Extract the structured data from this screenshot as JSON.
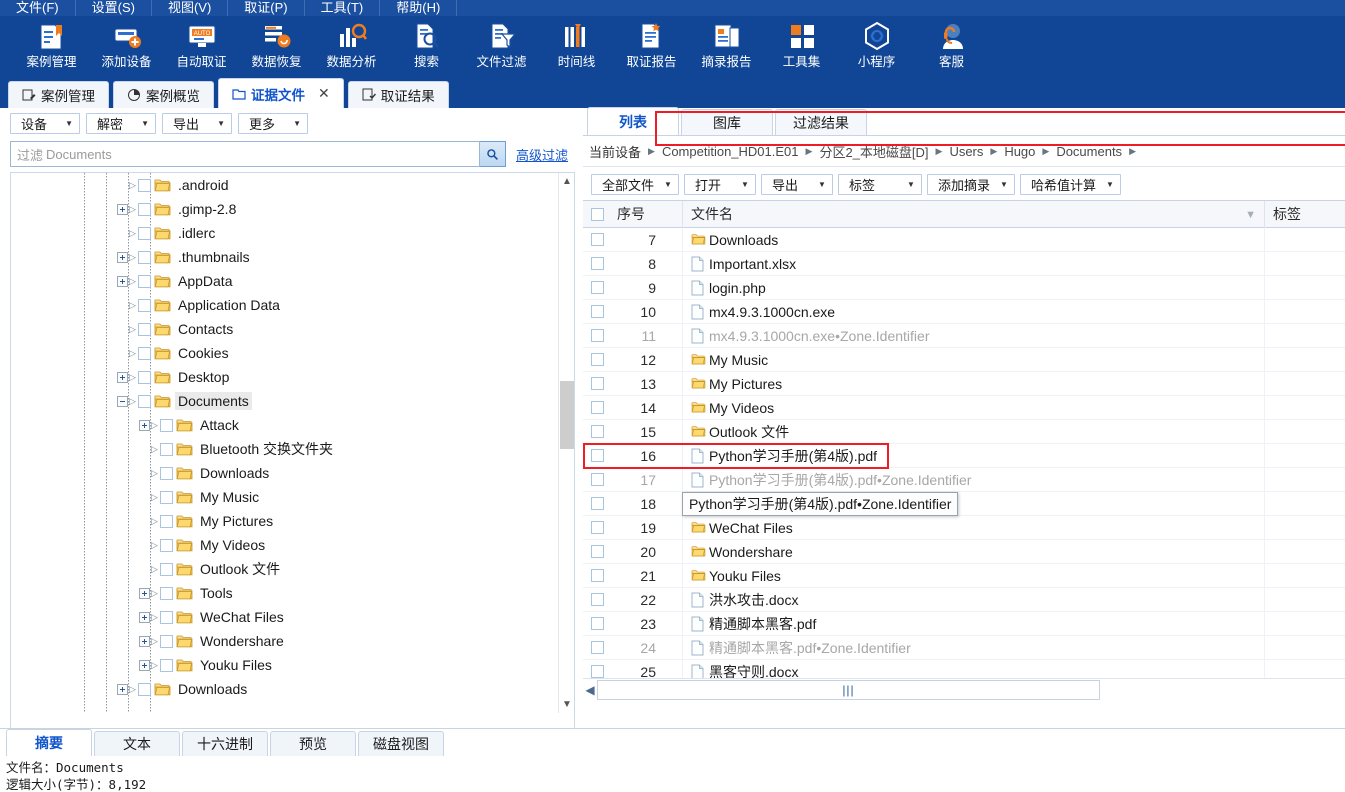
{
  "menubar": {
    "items": [
      {
        "label": "文件(F)"
      },
      {
        "label": "设置(S)"
      },
      {
        "label": "视图(V)"
      },
      {
        "label": "取证(P)"
      },
      {
        "label": "工具(T)"
      },
      {
        "label": "帮助(H)"
      }
    ]
  },
  "ribbon": {
    "buttons": [
      {
        "label": "案例管理",
        "icon": "case-management-icon"
      },
      {
        "label": "添加设备",
        "icon": "add-device-icon"
      },
      {
        "label": "自动取证",
        "icon": "auto-forensics-icon"
      },
      {
        "label": "数据恢复",
        "icon": "data-recovery-icon"
      },
      {
        "label": "数据分析",
        "icon": "data-analysis-icon"
      },
      {
        "label": "搜索",
        "icon": "search-doc-icon"
      },
      {
        "label": "文件过滤",
        "icon": "file-filter-icon"
      },
      {
        "label": "时间线",
        "icon": "timeline-icon"
      },
      {
        "label": "取证报告",
        "icon": "forensic-report-icon"
      },
      {
        "label": "摘录报告",
        "icon": "excerpt-report-icon"
      },
      {
        "label": "工具集",
        "icon": "toolset-icon"
      },
      {
        "label": "小程序",
        "icon": "mini-program-icon"
      },
      {
        "label": "客服",
        "icon": "customer-service-icon"
      }
    ]
  },
  "doc_tabs": [
    {
      "label": "案例管理",
      "icon": "case-edit-icon",
      "active": false,
      "closable": false
    },
    {
      "label": "案例概览",
      "icon": "overview-pie-icon",
      "active": false,
      "closable": false
    },
    {
      "label": "证据文件",
      "icon": "evidence-folder-icon",
      "active": true,
      "closable": true,
      "close_glyph": "✕"
    },
    {
      "label": "取证结果",
      "icon": "result-check-icon",
      "active": false,
      "closable": false
    }
  ],
  "left_panel": {
    "toolbar": [
      {
        "label": "设备"
      },
      {
        "label": "解密"
      },
      {
        "label": "导出"
      },
      {
        "label": "更多"
      }
    ],
    "filter": {
      "prefix": "过滤",
      "value": "Documents",
      "placeholder": "过滤 Documents",
      "search_icon": "search-icon",
      "advanced_label": "高级过滤"
    },
    "tree": [
      {
        "label": ".android",
        "depth": 1,
        "expander": "none",
        "selected": false
      },
      {
        "label": ".gimp-2.8",
        "depth": 1,
        "expander": "plus",
        "selected": false
      },
      {
        "label": ".idlerc",
        "depth": 1,
        "expander": "none",
        "selected": false
      },
      {
        "label": ".thumbnails",
        "depth": 1,
        "expander": "plus",
        "selected": false
      },
      {
        "label": "AppData",
        "depth": 1,
        "expander": "plus",
        "selected": false
      },
      {
        "label": "Application Data",
        "depth": 1,
        "expander": "none",
        "selected": false
      },
      {
        "label": "Contacts",
        "depth": 1,
        "expander": "none",
        "selected": false
      },
      {
        "label": "Cookies",
        "depth": 1,
        "expander": "none",
        "selected": false
      },
      {
        "label": "Desktop",
        "depth": 1,
        "expander": "plus",
        "selected": false
      },
      {
        "label": "Documents",
        "depth": 1,
        "expander": "minus",
        "selected": true
      },
      {
        "label": "Attack",
        "depth": 2,
        "expander": "plus",
        "selected": false
      },
      {
        "label": "Bluetooth 交换文件夹",
        "depth": 2,
        "expander": "none",
        "selected": false
      },
      {
        "label": "Downloads",
        "depth": 2,
        "expander": "none",
        "selected": false
      },
      {
        "label": "My Music",
        "depth": 2,
        "expander": "none",
        "selected": false
      },
      {
        "label": "My Pictures",
        "depth": 2,
        "expander": "none",
        "selected": false
      },
      {
        "label": "My Videos",
        "depth": 2,
        "expander": "none",
        "selected": false
      },
      {
        "label": "Outlook 文件",
        "depth": 2,
        "expander": "none",
        "selected": false
      },
      {
        "label": "Tools",
        "depth": 2,
        "expander": "plus",
        "selected": false
      },
      {
        "label": "WeChat Files",
        "depth": 2,
        "expander": "plus",
        "selected": false
      },
      {
        "label": "Wondershare",
        "depth": 2,
        "expander": "plus",
        "selected": false
      },
      {
        "label": "Youku Files",
        "depth": 2,
        "expander": "plus",
        "selected": false
      },
      {
        "label": "Downloads",
        "depth": 1,
        "expander": "plus",
        "selected": false
      }
    ]
  },
  "right_panel": {
    "tabs": [
      {
        "label": "列表",
        "active": true
      },
      {
        "label": "图库",
        "active": false
      },
      {
        "label": "过滤结果",
        "active": false
      }
    ],
    "breadcrumb": {
      "root_label": "当前设备",
      "items": [
        {
          "label": "Competition_HD01.E01"
        },
        {
          "label": "分区2_本地磁盘[D]"
        },
        {
          "label": "Users"
        },
        {
          "label": "Hugo"
        },
        {
          "label": "Documents"
        }
      ],
      "separator": "▶",
      "highlight_color": "#ee1c25"
    },
    "toolbar": [
      {
        "label": "全部文件"
      },
      {
        "label": "打开"
      },
      {
        "label": "导出"
      },
      {
        "label": "标签"
      },
      {
        "label": "添加摘录"
      },
      {
        "label": "哈希值计算"
      }
    ],
    "table": {
      "columns": [
        {
          "key": "index",
          "label": "序号"
        },
        {
          "key": "name",
          "label": "文件名",
          "has_filter_icon": true
        },
        {
          "key": "tag",
          "label": "标签"
        }
      ],
      "rows": [
        {
          "index": "7",
          "name": "Downloads",
          "type": "folder",
          "dim": false,
          "tag": ""
        },
        {
          "index": "8",
          "name": "Important.xlsx",
          "type": "file",
          "dim": false,
          "tag": ""
        },
        {
          "index": "9",
          "name": "login.php",
          "type": "file",
          "dim": false,
          "tag": ""
        },
        {
          "index": "10",
          "name": "mx4.9.3.1000cn.exe",
          "type": "file",
          "dim": false,
          "tag": ""
        },
        {
          "index": "11",
          "name": "mx4.9.3.1000cn.exe•Zone.Identifier",
          "type": "file",
          "dim": true,
          "tag": ""
        },
        {
          "index": "12",
          "name": "My Music",
          "type": "folder",
          "dim": false,
          "tag": ""
        },
        {
          "index": "13",
          "name": "My Pictures",
          "type": "folder",
          "dim": false,
          "tag": ""
        },
        {
          "index": "14",
          "name": "My Videos",
          "type": "folder",
          "dim": false,
          "tag": ""
        },
        {
          "index": "15",
          "name": "Outlook 文件",
          "type": "folder",
          "dim": false,
          "tag": ""
        },
        {
          "index": "16",
          "name": "Python学习手册(第4版).pdf",
          "type": "file",
          "dim": false,
          "tag": "",
          "highlighted": true
        },
        {
          "index": "17",
          "name": "Python学习手册(第4版).pdf•Zone.Identifier",
          "type": "file",
          "dim": true,
          "tag": ""
        },
        {
          "index": "18",
          "name": "Tools",
          "type": "folder",
          "dim": false,
          "tag": ""
        },
        {
          "index": "19",
          "name": "WeChat Files",
          "type": "folder",
          "dim": false,
          "tag": ""
        },
        {
          "index": "20",
          "name": "Wondershare",
          "type": "folder",
          "dim": false,
          "tag": ""
        },
        {
          "index": "21",
          "name": "Youku Files",
          "type": "folder",
          "dim": false,
          "tag": ""
        },
        {
          "index": "22",
          "name": "洪水攻击.docx",
          "type": "file",
          "dim": false,
          "tag": ""
        },
        {
          "index": "23",
          "name": "精通脚本黑客.pdf",
          "type": "file",
          "dim": false,
          "tag": ""
        },
        {
          "index": "24",
          "name": "精通脚本黑客.pdf•Zone.Identifier",
          "type": "file",
          "dim": true,
          "tag": ""
        },
        {
          "index": "25",
          "name": "黑客守则.docx",
          "type": "file",
          "dim": false,
          "tag": ""
        }
      ]
    },
    "tooltip": {
      "text": "Python学习手册(第4版).pdf•Zone.Identifier"
    }
  },
  "bottom_panel": {
    "tabs": [
      {
        "label": "摘要",
        "active": true
      },
      {
        "label": "文本",
        "active": false
      },
      {
        "label": "十六进制",
        "active": false
      },
      {
        "label": "预览",
        "active": false
      },
      {
        "label": "磁盘视图",
        "active": false
      }
    ],
    "info_lines": [
      "文件名：Documents",
      "逻辑大小(字节)：8,192"
    ]
  }
}
